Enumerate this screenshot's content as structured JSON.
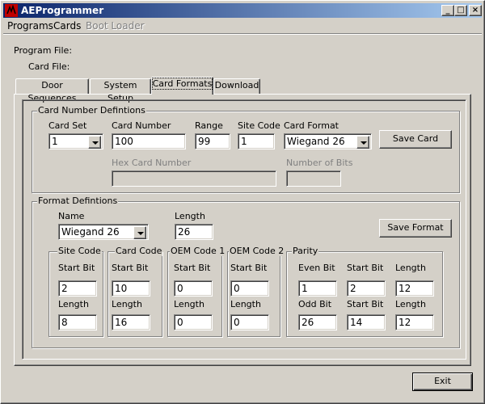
{
  "window": {
    "title": "AEProgrammer",
    "minimize_glyph": "_",
    "maximize_glyph": "□",
    "close_glyph": "×"
  },
  "menu": {
    "programs": "Programs",
    "cards": "Cards",
    "boot_loader": "Boot Loader"
  },
  "info": {
    "program_file_label": "Program File:",
    "card_file_label": "Card File:"
  },
  "tabs": [
    "Door Sequences",
    "System Setup",
    "Card Formats",
    "Download"
  ],
  "card_number": {
    "group_title": "Card Number Defintions",
    "card_set_label": "Card Set",
    "card_set_value": "1",
    "card_number_label": "Card Number",
    "card_number_value": "100",
    "range_label": "Range",
    "range_value": "99",
    "site_code_label": "Site Code",
    "site_code_value": "1",
    "card_format_label": "Card Format",
    "card_format_value": "Wiegand 26",
    "save_card": "Save Card",
    "hex_label": "Hex Card Number",
    "hex_value": "",
    "bits_label": "Number of Bits",
    "bits_value": ""
  },
  "format": {
    "group_title": "Format Defintions",
    "name_label": "Name",
    "name_value": "Wiegand 26",
    "length_label": "Length",
    "length_value": "26",
    "save_format": "Save Format",
    "site_code": {
      "title": "Site Code",
      "start_label": "Start Bit",
      "start": "2",
      "length_label": "Length",
      "length": "8"
    },
    "card_code": {
      "title": "Card Code",
      "start_label": "Start Bit",
      "start": "10",
      "length_label": "Length",
      "length": "16"
    },
    "oem1": {
      "title": "OEM Code 1",
      "start_label": "Start Bit",
      "start": "0",
      "length_label": "Length",
      "length": "0"
    },
    "oem2": {
      "title": "OEM Code 2",
      "start_label": "Start Bit",
      "start": "0",
      "length_label": "Length",
      "length": "0"
    },
    "parity": {
      "title": "Parity",
      "even_label": "Even Bit",
      "even": "1",
      "even_start_label": "Start Bit",
      "even_start": "2",
      "even_length_label": "Length",
      "even_length": "12",
      "odd_label": "Odd Bit",
      "odd": "26",
      "odd_start_label": "Start Bit",
      "odd_start": "14",
      "odd_length_label": "Length",
      "odd_length": "12"
    }
  },
  "footer": {
    "exit": "Exit"
  }
}
